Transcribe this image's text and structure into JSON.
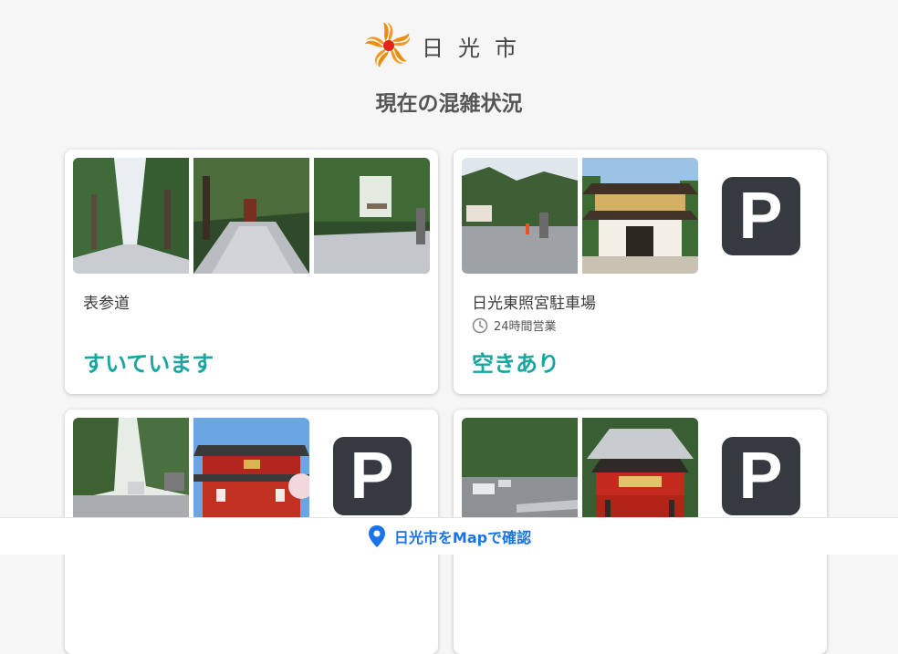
{
  "header": {
    "city_name": "日光市",
    "title": "現在の混雑状況"
  },
  "cards": [
    {
      "name": "表参道",
      "status": "すいています",
      "hours": "",
      "images": [
        "cedar-avenue-photo",
        "stone-path-photo",
        "shrine-path-photo"
      ],
      "has_parking_icon": false
    },
    {
      "name": "日光東照宮駐車場",
      "status": "空きあり",
      "hours": "24時間営業",
      "images": [
        "parking-lot-photo",
        "yomeimon-gate-photo"
      ],
      "has_parking_icon": true,
      "parking_label": "P"
    },
    {
      "name": "",
      "status": "",
      "hours": "",
      "images": [
        "tree-road-photo",
        "red-temple-photo"
      ],
      "has_parking_icon": true,
      "parking_label": "P"
    },
    {
      "name": "",
      "status": "",
      "hours": "",
      "images": [
        "forest-lot-photo",
        "red-shrine-photo"
      ],
      "has_parking_icon": true,
      "parking_label": "P"
    }
  ],
  "footer": {
    "map_link_label": "日光市をMapで確認",
    "icon": "map-pin-icon"
  },
  "colors": {
    "status_accent": "#1aa6a0",
    "link": "#1a73e8",
    "parking_icon_bg": "#353a40",
    "logo_orange": "#f29a1f",
    "logo_red": "#e2231a"
  }
}
